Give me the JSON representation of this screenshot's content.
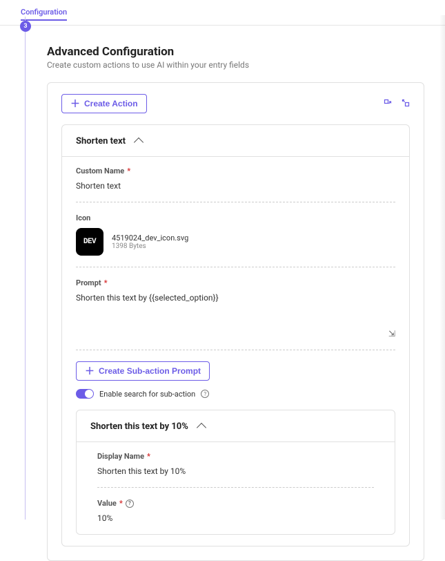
{
  "tab": {
    "label": "Configuration"
  },
  "step": {
    "number": "3"
  },
  "section": {
    "title": "Advanced Configuration",
    "description": "Create custom actions to use AI within your entry fields"
  },
  "buttons": {
    "create_action": "Create Action",
    "create_sub_action": "Create Sub-action Prompt"
  },
  "action": {
    "title": "Shorten text",
    "custom_name_label": "Custom Name",
    "custom_name_value": "Shorten text",
    "icon_label": "Icon",
    "icon_filename": "4519024_dev_icon.svg",
    "icon_size": "1398 Bytes",
    "icon_glyph": "DEV",
    "prompt_label": "Prompt",
    "prompt_value": "Shorten this text by {{selected_option}}"
  },
  "toggle": {
    "label": "Enable search for sub-action"
  },
  "subaction": {
    "title": "Shorten this text by 10%",
    "display_name_label": "Display Name",
    "display_name_value": "Shorten this text by 10%",
    "value_label": "Value",
    "value_value": "10%"
  }
}
